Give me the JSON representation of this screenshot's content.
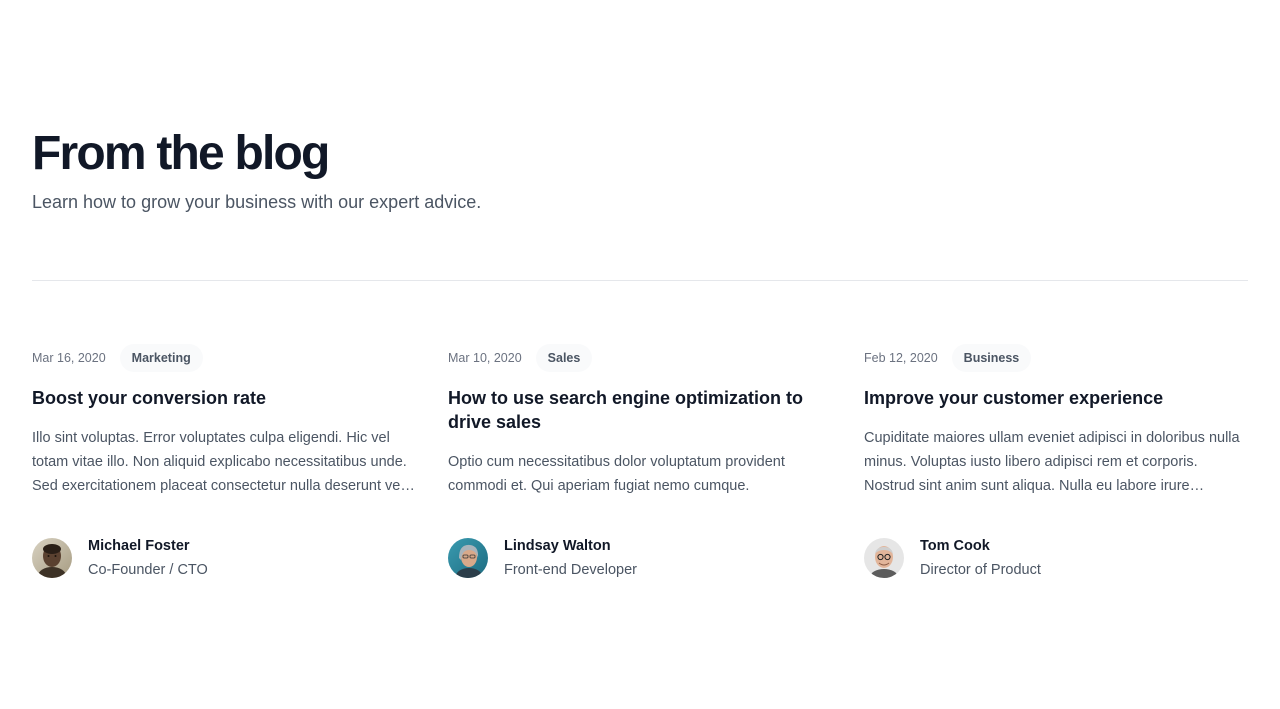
{
  "header": {
    "title": "From the blog",
    "subtitle": "Learn how to grow your business with our expert advice."
  },
  "posts": [
    {
      "date": "Mar 16, 2020",
      "category": "Marketing",
      "title": "Boost your conversion rate",
      "excerpt": "Illo sint voluptas. Error voluptates culpa eligendi. Hic vel totam vitae illo. Non aliquid explicabo necessitatibus unde. Sed exercitationem placeat consectetur nulla deserunt vel. Iusto corrupti dicta.",
      "author": {
        "name": "Michael Foster",
        "role": "Co-Founder / CTO"
      }
    },
    {
      "date": "Mar 10, 2020",
      "category": "Sales",
      "title": "How to use search engine optimization to drive sales",
      "excerpt": "Optio cum necessitatibus dolor voluptatum provident commodi et. Qui aperiam fugiat nemo cumque.",
      "author": {
        "name": "Lindsay Walton",
        "role": "Front-end Developer"
      }
    },
    {
      "date": "Feb 12, 2020",
      "category": "Business",
      "title": "Improve your customer experience",
      "excerpt": "Cupiditate maiores ullam eveniet adipisci in doloribus nulla minus. Voluptas iusto libero adipisci rem et corporis. Nostrud sint anim sunt aliqua. Nulla eu labore irure incididunt velit cillum quis magna dolore.",
      "author": {
        "name": "Tom Cook",
        "role": "Director of Product"
      }
    }
  ]
}
